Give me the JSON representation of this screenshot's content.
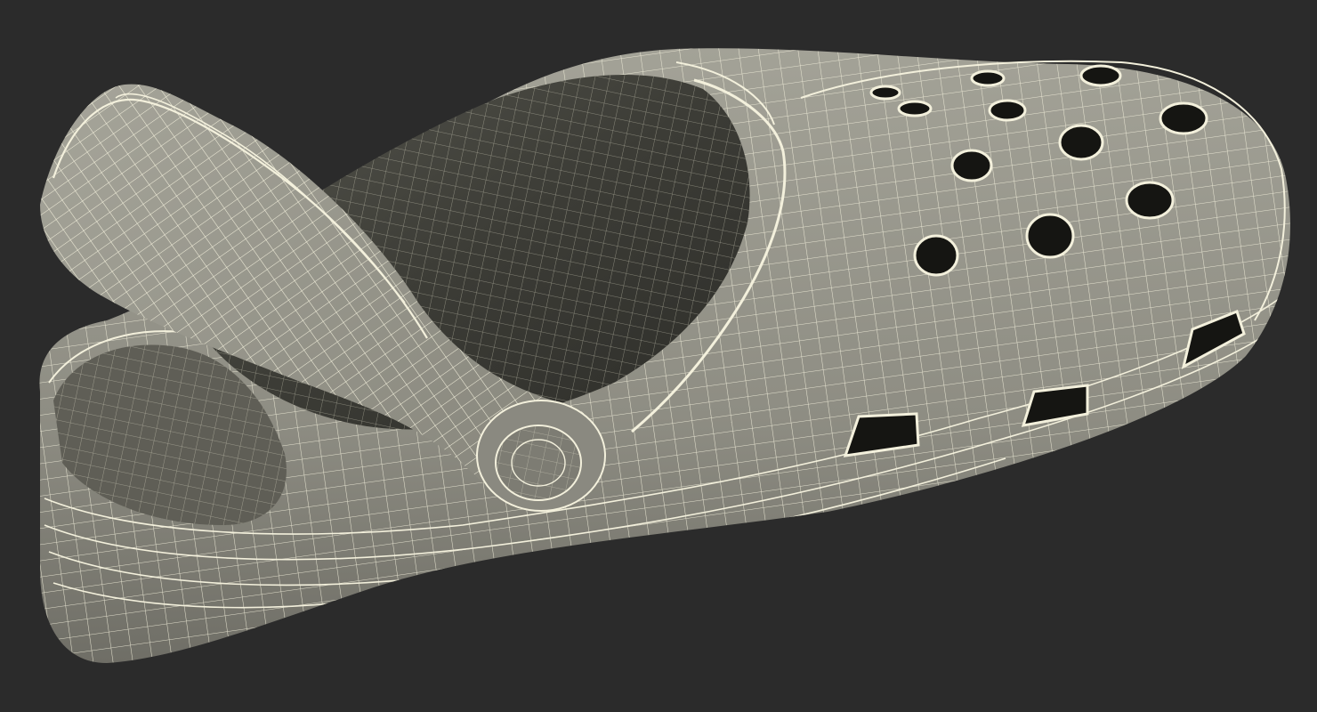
{
  "scene": {
    "background_color": "#2b2b2b",
    "object": "clog-wireframe-render",
    "shading": {
      "surface_color": "#8f8e84",
      "interior_color": "#4a4a42",
      "dark_interior_color": "#2a2a26",
      "wire_color": "#f3f0dc",
      "hole_color": "#151512"
    }
  }
}
